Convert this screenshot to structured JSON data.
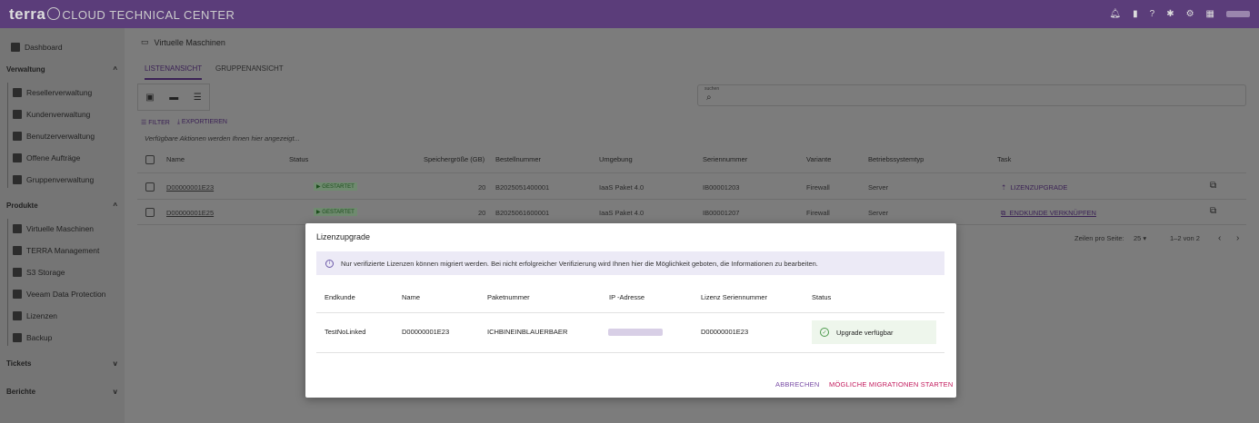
{
  "topbar": {
    "logo": "terra",
    "subtitle": "CLOUD TECHNICAL CENTER",
    "icons": [
      "bell-icon",
      "document-icon",
      "help-icon",
      "settings-icon",
      "gear-icon",
      "qr-icon"
    ]
  },
  "sidebar": {
    "dashboard": "Dashboard",
    "sections": {
      "verwaltung": "Verwaltung",
      "produkte": "Produkte",
      "tickets": "Tickets",
      "berichte": "Berichte"
    },
    "verwaltung_items": [
      "Resellerverwaltung",
      "Kundenverwaltung",
      "Benutzerverwaltung",
      "Offene Aufträge",
      "Gruppenverwaltung"
    ],
    "produkte_items": [
      "Virtuelle Maschinen",
      "TERRA Management",
      "S3 Storage",
      "Veeam Data Protection",
      "Lizenzen",
      "Backup"
    ]
  },
  "main": {
    "title": "Virtuelle Maschinen",
    "tabs": [
      "LISTENANSICHT",
      "GRUPPENANSICHT"
    ],
    "search_label": "suchen",
    "filter": "FILTER",
    "export": "EXPORTIEREN",
    "hint": "Verfügbare Aktionen werden Ihnen hier angezeigt...",
    "columns": [
      "Name",
      "Status",
      "Speichergröße (GB)",
      "Bestellnummer",
      "Umgebung",
      "Seriennummer",
      "Variante",
      "Betriebssystemtyp",
      "Task"
    ],
    "rows": [
      {
        "name": "D00000001E23",
        "status": "▶ GESTARTET",
        "size": "20",
        "order": "B2025051400001",
        "env": "IaaS Paket 4.0",
        "serial": "IB00001203",
        "variant": "Firewall",
        "os": "Server",
        "task": "LIZENZUPGRADE"
      },
      {
        "name": "D00000001E25",
        "status": "▶ GESTARTET",
        "size": "20",
        "order": "B2025061600001",
        "env": "IaaS Paket 4.0",
        "serial": "IB00001207",
        "variant": "Firewall",
        "os": "Server",
        "task": "ENDKUNDE VERKNÜPFEN"
      }
    ],
    "pagination": {
      "per_page_label": "Zeilen pro Seite:",
      "per_page": "25",
      "range": "1–2 von 2"
    }
  },
  "modal": {
    "title": "Lizenzupgrade",
    "info": "Nur verifizierte Lizenzen können migriert werden. Bei nicht erfolgreicher Verifizierung wird Ihnen hier die Möglichkeit geboten, die Informationen zu bearbeiten.",
    "columns": [
      "Endkunde",
      "Name",
      "Paketnummer",
      "IP -Adresse",
      "Lizenz Seriennummer",
      "Status"
    ],
    "row": {
      "customer": "TestNoLinked",
      "name": "D00000001E23",
      "package": "ICHBINEINBLAUERBAER",
      "serial": "D00000001E23",
      "status": "Upgrade verfügbar"
    },
    "cancel": "ABBRECHEN",
    "start": "MÖGLICHE MIGRATIONEN STARTEN"
  }
}
